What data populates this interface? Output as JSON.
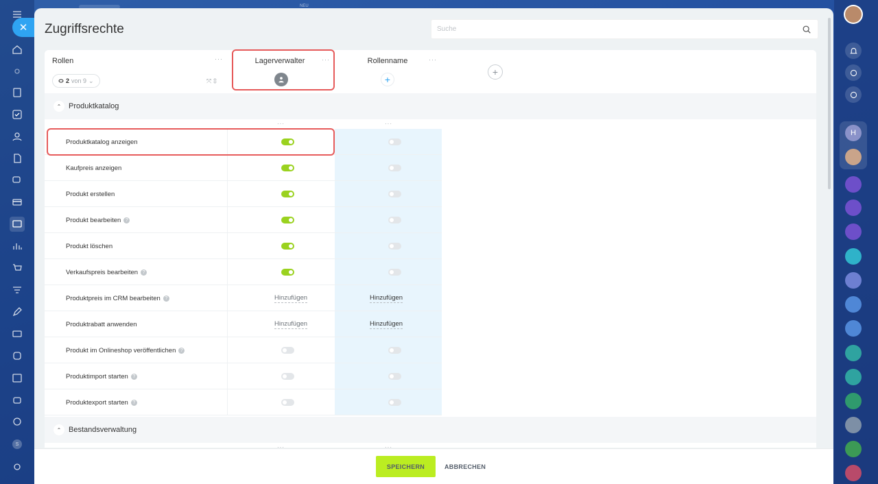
{
  "panel": {
    "title": "Zugriffsrechte",
    "search_placeholder": "Suche"
  },
  "topbar": {
    "new_label": "NEU"
  },
  "table": {
    "roles_header": "Rollen",
    "counter": {
      "shown": "2",
      "of_text": "von 9"
    },
    "columns": [
      {
        "title": "Lagerverwalter",
        "avatar": "user-icon"
      },
      {
        "title": "Rollenname",
        "avatar": "plus-icon"
      }
    ],
    "sections": [
      {
        "label": "Produktkatalog",
        "rows": [
          {
            "name": "Produktkatalog anzeigen",
            "help": false,
            "col1": "on",
            "col2": "off"
          },
          {
            "name": "Kaufpreis anzeigen",
            "help": false,
            "col1": "on",
            "col2": "off"
          },
          {
            "name": "Produkt erstellen",
            "help": false,
            "col1": "on",
            "col2": "off"
          },
          {
            "name": "Produkt bearbeiten",
            "help": true,
            "col1": "on",
            "col2": "off"
          },
          {
            "name": "Produkt löschen",
            "help": false,
            "col1": "on",
            "col2": "off"
          },
          {
            "name": "Verkaufspreis bearbeiten",
            "help": true,
            "col1": "on",
            "col2": "off"
          },
          {
            "name": "Produktpreis im CRM bearbeiten",
            "help": true,
            "col1": "Hinzufügen",
            "col2": "Hinzufügen"
          },
          {
            "name": "Produktrabatt anwenden",
            "help": false,
            "col1": "Hinzufügen",
            "col2": "Hinzufügen"
          },
          {
            "name": "Produkt im Onlineshop veröffentlichen",
            "help": true,
            "col1": "off",
            "col2": "off"
          },
          {
            "name": "Produktimport starten",
            "help": true,
            "col1": "off",
            "col2": "off"
          },
          {
            "name": "Produktexport starten",
            "help": true,
            "col1": "off",
            "col2": "off"
          }
        ]
      },
      {
        "label": "Bestandsverwaltung",
        "rows": []
      }
    ]
  },
  "footer": {
    "save_label": "SPEICHERN",
    "cancel_label": "ABBRECHEN"
  },
  "colors": {
    "toggle_on": "#9ad21f",
    "accent": "#2fa4f2",
    "save": "#bbed21",
    "highlight": "#e65a5a"
  },
  "right_rail": {
    "initial_letter": "H"
  },
  "left_rail": {
    "bottom_letter": "S"
  }
}
